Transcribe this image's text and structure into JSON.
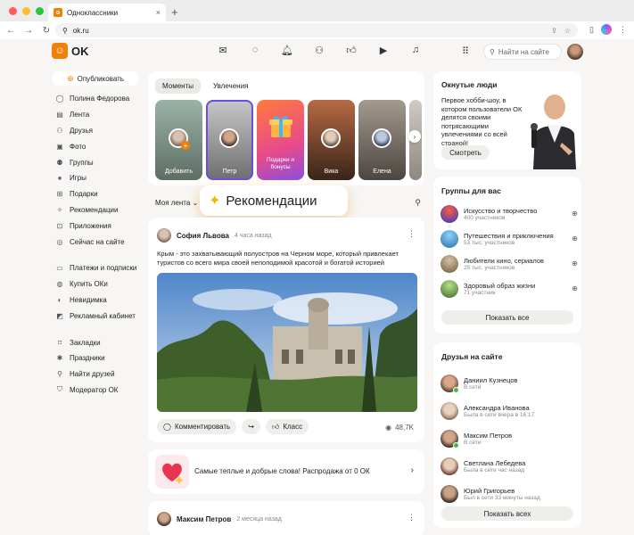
{
  "browser": {
    "tab_title": "Одноклассники",
    "tab_close": "×",
    "new_tab": "+",
    "url": "ok.ru"
  },
  "header": {
    "logo_text": "OK",
    "search_placeholder": "Найти на сайте"
  },
  "sidebar": {
    "publish_label": "Опубликовать",
    "items": [
      {
        "label": "Полина Федорова",
        "icon": "user-icon"
      },
      {
        "label": "Лента",
        "icon": "feed-icon"
      },
      {
        "label": "Друзья",
        "icon": "friends-icon"
      },
      {
        "label": "Фото",
        "icon": "photo-icon"
      },
      {
        "label": "Группы",
        "icon": "groups-icon"
      },
      {
        "label": "Игры",
        "icon": "games-icon"
      },
      {
        "label": "Подарки",
        "icon": "gift-icon"
      },
      {
        "label": "Рекомендации",
        "icon": "recommendations-icon"
      },
      {
        "label": "Приложения",
        "icon": "apps-icon"
      },
      {
        "label": "Сейчас на сайте",
        "icon": "online-icon"
      }
    ],
    "items2": [
      {
        "label": "Платежи и подписки",
        "icon": "payments-icon"
      },
      {
        "label": "Купить ОКи",
        "icon": "coin-icon"
      },
      {
        "label": "Невидимка",
        "icon": "invisible-icon"
      },
      {
        "label": "Рекламный кабинет",
        "icon": "ads-icon"
      }
    ],
    "items3": [
      {
        "label": "Закладки",
        "icon": "bookmark-icon"
      },
      {
        "label": "Праздники",
        "icon": "holiday-icon"
      },
      {
        "label": "Найти друзей",
        "icon": "find-friends-icon"
      },
      {
        "label": "Модератор ОК",
        "icon": "moderator-icon"
      }
    ]
  },
  "moments": {
    "tabs": [
      "Моменты",
      "Увлечения"
    ],
    "stories": [
      "Добавить",
      "Петр",
      "Подарки и бонусы",
      "Вика",
      "Елена"
    ]
  },
  "feed": {
    "selector": "Моя лента",
    "badge": "Рекомендации"
  },
  "post": {
    "author": "София Львова",
    "time": "4 часа назад",
    "text": "Крым - это захватывающий полуостров на Черном море, который привлекает туристов со всего мира своей непоподимой красотой и богатой историей",
    "comment_label": "Комментировать",
    "like_label": "Класс",
    "views": "48,7K"
  },
  "promo": {
    "text": "Самые теплые и добрые слова! Распродажа от 0 ОК"
  },
  "post2": {
    "author": "Максим Петров",
    "time": "2 месяца назад"
  },
  "okn": {
    "title": "Окнутые люди",
    "desc": "Первое хобби-шоу, в котором пользователи ОК делятся своими потрясающими увлечениями со всей страной!",
    "button": "Смотреть"
  },
  "groups": {
    "title": "Группы для вас",
    "items": [
      {
        "name": "Искусство и творчество",
        "sub": "400 участников"
      },
      {
        "name": "Путешествия и приключения",
        "sub": "53 тыс. участников"
      },
      {
        "name": "Любители кино, сериалов",
        "sub": "25 тыс. участников"
      },
      {
        "name": "Здоровый образ жизни",
        "sub": "71 участник"
      }
    ],
    "show_all": "Показать все"
  },
  "friends": {
    "title": "Друзья на сайте",
    "items": [
      {
        "name": "Даниил Кузнецов",
        "sub": "В сети"
      },
      {
        "name": "Александра Иванова",
        "sub": "Была в сети вчера в 16:17"
      },
      {
        "name": "Максим Петров",
        "sub": "В сети"
      },
      {
        "name": "Светлана Лебедева",
        "sub": "Была в сети час назад"
      },
      {
        "name": "Юрий Григорьев",
        "sub": "Был в сети 33 минуты назад"
      }
    ],
    "show_all": "Показать всех"
  },
  "colors": {
    "brand": "#ee8208",
    "online": "#3dba50",
    "accent": "#6b4ee6"
  }
}
